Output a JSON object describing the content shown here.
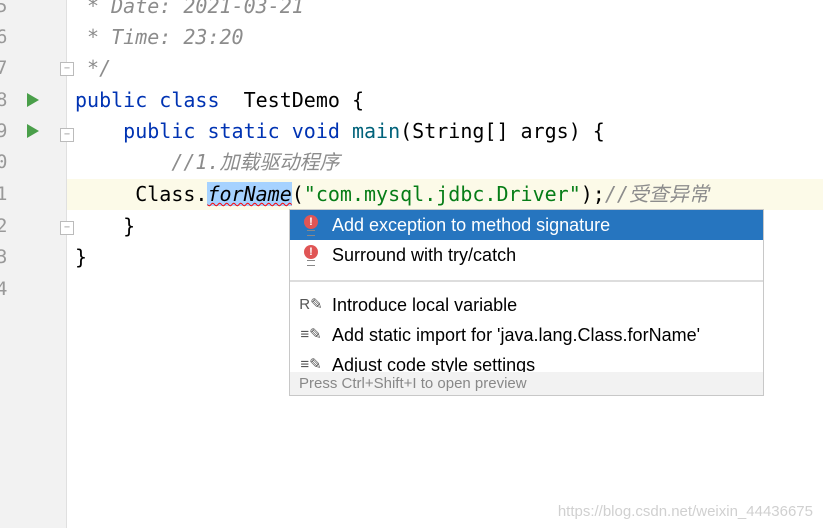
{
  "editor": {
    "line_numbers": [
      "5",
      "6",
      "7",
      "8",
      "9",
      "0",
      "1",
      "2",
      "3",
      "4"
    ],
    "lines": {
      "l5": " * Date: 2021-03-21",
      "l6": " * Time: 23:20",
      "l7": " */",
      "l8_kw": "public class",
      "l8_name": "  TestDemo {",
      "l9_indent": "    ",
      "l9_kw": "public static void",
      "l9_fn": "main",
      "l9_rest": "(String[] args) {",
      "l10": "        //1.加载驱动程序",
      "l11_pre": "     Class.",
      "l11_sel": "forName",
      "l11_open": "(",
      "l11_str": "\"com.mysql.jdbc.Driver\"",
      "l11_close": ");",
      "l11_cm": "//受查异常",
      "l12": "    }",
      "l13": "}"
    }
  },
  "popup": {
    "items": [
      {
        "label": "Add exception to method signature",
        "icon": "error-bulb-icon"
      },
      {
        "label": "Surround with try/catch",
        "icon": "error-bulb-icon"
      },
      {
        "label": "Introduce local variable",
        "icon": "refactor-icon"
      },
      {
        "label": "Add static import for 'java.lang.Class.forName'",
        "icon": "intention-icon"
      },
      {
        "label": "Adjust code style settings",
        "icon": "intention-icon"
      }
    ],
    "footer": "Press Ctrl+Shift+I to open preview",
    "selected_color": "#2675bf"
  },
  "watermark": "https://blog.csdn.net/weixin_44436675"
}
